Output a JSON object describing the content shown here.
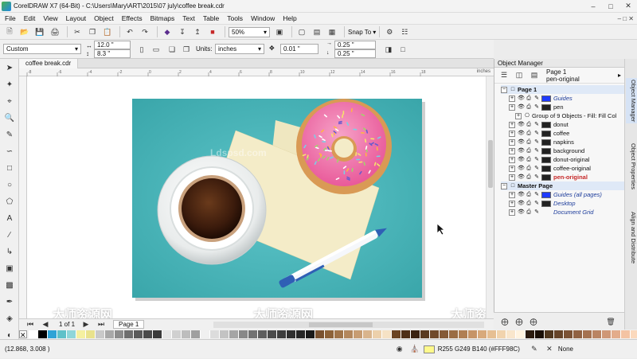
{
  "window": {
    "title": "CorelDRAW X7 (64-Bit) - C:\\Users\\Mary\\ART\\2015\\07 july\\coffee break.cdr"
  },
  "menu": [
    "File",
    "Edit",
    "View",
    "Layout",
    "Object",
    "Effects",
    "Bitmaps",
    "Text",
    "Table",
    "Tools",
    "Window",
    "Help"
  ],
  "toolbar": {
    "zoom": "50%",
    "snap_to": "Snap To"
  },
  "propertybar": {
    "preset": "Custom",
    "width": "12.0 \"",
    "height": "8.3 \"",
    "units_label": "Units:",
    "units": "inches",
    "nudge": "0.01 \"",
    "dup_x": "0.25 \"",
    "dup_y": "0.25 \""
  },
  "document_tab": "coffee break.cdr",
  "ruler": {
    "unit": "inches",
    "ticks": [
      "-8",
      "-6",
      "-4",
      "-2",
      "0",
      "2",
      "4",
      "6",
      "8",
      "10",
      "12",
      "14",
      "16",
      "18"
    ]
  },
  "page_nav": {
    "count": "1 of 1",
    "page_tab": "Page 1"
  },
  "watermarks": [
    "Ldspsd.com",
    "Ldspsd.com",
    "大师资源网",
    "大师资源网",
    "大师资源网"
  ],
  "status": {
    "coords": "(12.868, 3.008 )",
    "fill_info": "R255 G249 B140 (#FFF98C)",
    "outline": "None"
  },
  "object_manager": {
    "title": "Object Manager",
    "page_label": "Page 1",
    "active_layer": "pen-original",
    "page1": {
      "label": "Page 1",
      "layers": [
        {
          "name": "Guides",
          "color": "#1f3bff",
          "italic": true
        },
        {
          "name": "pen",
          "color": "#222222",
          "italic": false
        },
        {
          "name": "Group of 9 Objects - Fill: Fill Col",
          "color": "",
          "italic": false,
          "child": true
        },
        {
          "name": "donut",
          "color": "#222222",
          "italic": false
        },
        {
          "name": "coffee",
          "color": "#222222",
          "italic": false
        },
        {
          "name": "napkins",
          "color": "#222222",
          "italic": false
        },
        {
          "name": "background",
          "color": "#222222",
          "italic": false
        },
        {
          "name": "donut-original",
          "color": "#222222",
          "italic": false
        },
        {
          "name": "coffee-original",
          "color": "#222222",
          "italic": false
        },
        {
          "name": "pen-original",
          "color": "#222222",
          "italic": false,
          "active": true
        }
      ]
    },
    "master": {
      "label": "Master Page",
      "layers": [
        {
          "name": "Guides (all pages)",
          "color": "#1f3bff"
        },
        {
          "name": "Desktop",
          "color": "#222222"
        },
        {
          "name": "Document Grid",
          "color": ""
        }
      ]
    }
  },
  "dockers": [
    "Object Manager",
    "Object Properties",
    "Align and Distribute"
  ],
  "colors": {
    "artboard_bg": "#4fb9bd",
    "coffee": "#3a1a0c",
    "donut_icing": "#f06ca8",
    "donut_dough": "#d99a55",
    "napkin": "#f3ecc6"
  },
  "palette": [
    "#ffffff",
    "#000000",
    "#2ea3d6",
    "#5fc1c9",
    "#8fd6d9",
    "#f5f0a0",
    "#e9e28c",
    "#c9c9c9",
    "#a8a8a8",
    "#8c8c8c",
    "#6e6e6e",
    "#5a5a5a",
    "#4a4a4a",
    "#3a3a3a",
    "#e6e6e6",
    "#d0d0d0",
    "#bdbdbd",
    "#9f9f9f",
    "#f0f0f0",
    "#dcdcdc",
    "#c3c3c3",
    "#a5a5a5",
    "#888888",
    "#727272",
    "#5e5e5e",
    "#4b4b4b",
    "#3e3e3e",
    "#303030",
    "#262626",
    "#1a1a1a",
    "#7a5230",
    "#8d6239",
    "#a0744a",
    "#b3875d",
    "#c79c72",
    "#d9b48c",
    "#ecd0ab",
    "#f6e2c5",
    "#6b4423",
    "#4e2f17",
    "#3a2210",
    "#5a3a20",
    "#70492a",
    "#855a36",
    "#9a6c44",
    "#b07f54",
    "#c69467",
    "#d8a97b",
    "#e6bf93",
    "#f1d3ad",
    "#f9e6cc",
    "#fff3e0",
    "#2b1b0e",
    "#1a0f06",
    "#50371f",
    "#664429",
    "#7b5235",
    "#906142",
    "#a57251",
    "#ba8463",
    "#cf9776",
    "#e3ac8b",
    "#f4c3a3",
    "#fbd9bd",
    "#ffe9d6",
    "#000000"
  ]
}
